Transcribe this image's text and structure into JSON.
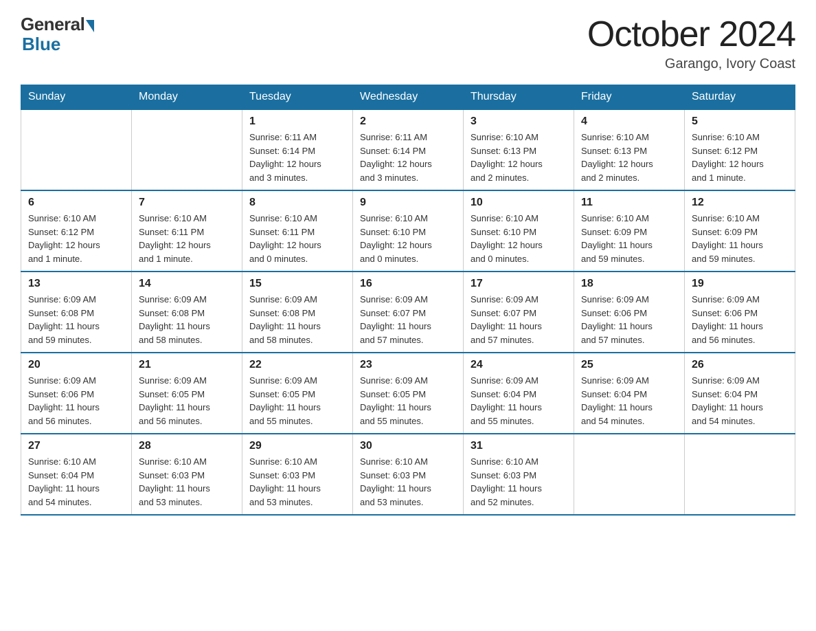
{
  "header": {
    "logo_general": "General",
    "logo_blue": "Blue",
    "month_title": "October 2024",
    "location": "Garango, Ivory Coast"
  },
  "weekdays": [
    "Sunday",
    "Monday",
    "Tuesday",
    "Wednesday",
    "Thursday",
    "Friday",
    "Saturday"
  ],
  "weeks": [
    [
      {
        "day": "",
        "info": ""
      },
      {
        "day": "",
        "info": ""
      },
      {
        "day": "1",
        "info": "Sunrise: 6:11 AM\nSunset: 6:14 PM\nDaylight: 12 hours\nand 3 minutes."
      },
      {
        "day": "2",
        "info": "Sunrise: 6:11 AM\nSunset: 6:14 PM\nDaylight: 12 hours\nand 3 minutes."
      },
      {
        "day": "3",
        "info": "Sunrise: 6:10 AM\nSunset: 6:13 PM\nDaylight: 12 hours\nand 2 minutes."
      },
      {
        "day": "4",
        "info": "Sunrise: 6:10 AM\nSunset: 6:13 PM\nDaylight: 12 hours\nand 2 minutes."
      },
      {
        "day": "5",
        "info": "Sunrise: 6:10 AM\nSunset: 6:12 PM\nDaylight: 12 hours\nand 1 minute."
      }
    ],
    [
      {
        "day": "6",
        "info": "Sunrise: 6:10 AM\nSunset: 6:12 PM\nDaylight: 12 hours\nand 1 minute."
      },
      {
        "day": "7",
        "info": "Sunrise: 6:10 AM\nSunset: 6:11 PM\nDaylight: 12 hours\nand 1 minute."
      },
      {
        "day": "8",
        "info": "Sunrise: 6:10 AM\nSunset: 6:11 PM\nDaylight: 12 hours\nand 0 minutes."
      },
      {
        "day": "9",
        "info": "Sunrise: 6:10 AM\nSunset: 6:10 PM\nDaylight: 12 hours\nand 0 minutes."
      },
      {
        "day": "10",
        "info": "Sunrise: 6:10 AM\nSunset: 6:10 PM\nDaylight: 12 hours\nand 0 minutes."
      },
      {
        "day": "11",
        "info": "Sunrise: 6:10 AM\nSunset: 6:09 PM\nDaylight: 11 hours\nand 59 minutes."
      },
      {
        "day": "12",
        "info": "Sunrise: 6:10 AM\nSunset: 6:09 PM\nDaylight: 11 hours\nand 59 minutes."
      }
    ],
    [
      {
        "day": "13",
        "info": "Sunrise: 6:09 AM\nSunset: 6:08 PM\nDaylight: 11 hours\nand 59 minutes."
      },
      {
        "day": "14",
        "info": "Sunrise: 6:09 AM\nSunset: 6:08 PM\nDaylight: 11 hours\nand 58 minutes."
      },
      {
        "day": "15",
        "info": "Sunrise: 6:09 AM\nSunset: 6:08 PM\nDaylight: 11 hours\nand 58 minutes."
      },
      {
        "day": "16",
        "info": "Sunrise: 6:09 AM\nSunset: 6:07 PM\nDaylight: 11 hours\nand 57 minutes."
      },
      {
        "day": "17",
        "info": "Sunrise: 6:09 AM\nSunset: 6:07 PM\nDaylight: 11 hours\nand 57 minutes."
      },
      {
        "day": "18",
        "info": "Sunrise: 6:09 AM\nSunset: 6:06 PM\nDaylight: 11 hours\nand 57 minutes."
      },
      {
        "day": "19",
        "info": "Sunrise: 6:09 AM\nSunset: 6:06 PM\nDaylight: 11 hours\nand 56 minutes."
      }
    ],
    [
      {
        "day": "20",
        "info": "Sunrise: 6:09 AM\nSunset: 6:06 PM\nDaylight: 11 hours\nand 56 minutes."
      },
      {
        "day": "21",
        "info": "Sunrise: 6:09 AM\nSunset: 6:05 PM\nDaylight: 11 hours\nand 56 minutes."
      },
      {
        "day": "22",
        "info": "Sunrise: 6:09 AM\nSunset: 6:05 PM\nDaylight: 11 hours\nand 55 minutes."
      },
      {
        "day": "23",
        "info": "Sunrise: 6:09 AM\nSunset: 6:05 PM\nDaylight: 11 hours\nand 55 minutes."
      },
      {
        "day": "24",
        "info": "Sunrise: 6:09 AM\nSunset: 6:04 PM\nDaylight: 11 hours\nand 55 minutes."
      },
      {
        "day": "25",
        "info": "Sunrise: 6:09 AM\nSunset: 6:04 PM\nDaylight: 11 hours\nand 54 minutes."
      },
      {
        "day": "26",
        "info": "Sunrise: 6:09 AM\nSunset: 6:04 PM\nDaylight: 11 hours\nand 54 minutes."
      }
    ],
    [
      {
        "day": "27",
        "info": "Sunrise: 6:10 AM\nSunset: 6:04 PM\nDaylight: 11 hours\nand 54 minutes."
      },
      {
        "day": "28",
        "info": "Sunrise: 6:10 AM\nSunset: 6:03 PM\nDaylight: 11 hours\nand 53 minutes."
      },
      {
        "day": "29",
        "info": "Sunrise: 6:10 AM\nSunset: 6:03 PM\nDaylight: 11 hours\nand 53 minutes."
      },
      {
        "day": "30",
        "info": "Sunrise: 6:10 AM\nSunset: 6:03 PM\nDaylight: 11 hours\nand 53 minutes."
      },
      {
        "day": "31",
        "info": "Sunrise: 6:10 AM\nSunset: 6:03 PM\nDaylight: 11 hours\nand 52 minutes."
      },
      {
        "day": "",
        "info": ""
      },
      {
        "day": "",
        "info": ""
      }
    ]
  ]
}
